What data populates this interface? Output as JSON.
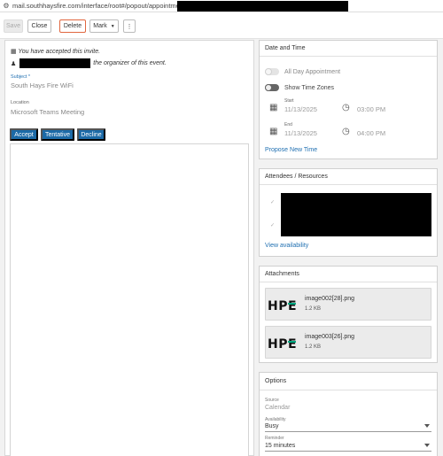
{
  "browser": {
    "url": "mail.southhaysfire.com/interface/root#/popout/appointment"
  },
  "toolbar": {
    "save": "Save",
    "close": "Close",
    "delete": "Delete",
    "mark": "Mark",
    "more": "⋮"
  },
  "invite": {
    "accepted_text": "You have accepted this invite.",
    "organizer_text": "the organizer of this event."
  },
  "subject": {
    "label": "Subject *",
    "value": "South Hays Fire WiFi"
  },
  "location": {
    "label": "Location",
    "value": "Microsoft Teams Meeting"
  },
  "rsvp": {
    "accept": "Accept",
    "tentative": "Tentative",
    "decline": "Decline"
  },
  "date_time": {
    "title": "Date and Time",
    "all_day": "All Day Appointment",
    "show_time_zones": "Show Time Zones",
    "start_label": "Start",
    "start_date": "11/13/2025",
    "start_time": "03:00 PM",
    "end_label": "End",
    "end_date": "11/13/2025",
    "end_time": "04:00 PM",
    "propose": "Propose New Time"
  },
  "attendees": {
    "title": "Attendees / Resources",
    "view_availability": "View availability"
  },
  "attachments": {
    "title": "Attachments",
    "items": [
      {
        "name": "image002[28].png",
        "size": "1.2 KB",
        "thumb": "HPE"
      },
      {
        "name": "image003[26].png",
        "size": "1.2 KB",
        "thumb": "HPE"
      }
    ]
  },
  "options": {
    "title": "Options",
    "source_label": "Source",
    "source_value": "Calendar",
    "availability_label": "Availability",
    "availability_value": "Busy",
    "reminder_label": "Reminder",
    "reminder_value": "15 minutes"
  },
  "colors": {
    "accent": "#1c6aa7",
    "link": "#1f6fb1",
    "delete_border": "#e0673f",
    "hpe_green": "#01a982"
  }
}
